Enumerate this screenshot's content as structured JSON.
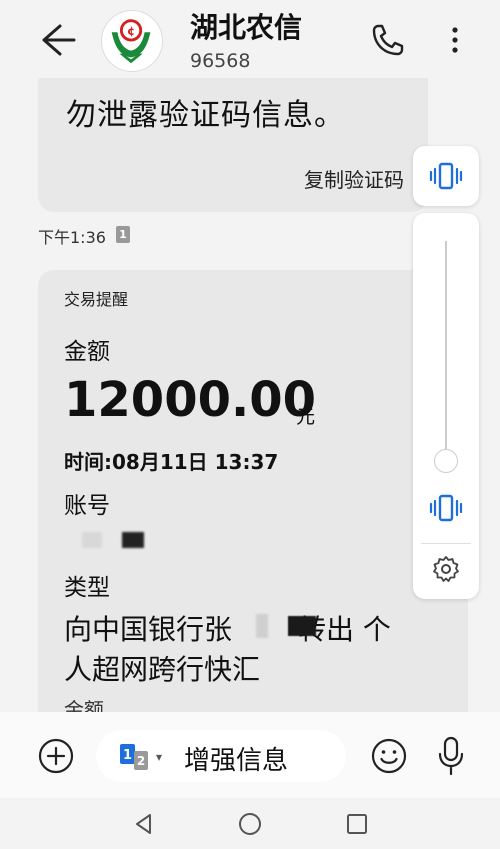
{
  "header": {
    "contact_name": "湖北农信",
    "contact_number": "96568"
  },
  "messages": [
    {
      "text": "勿泄露验证码信息。",
      "action": "复制验证码"
    }
  ],
  "timestamp": {
    "time": "下午1:36",
    "sim": "1"
  },
  "transaction": {
    "title": "交易提醒",
    "amount_label": "金额",
    "amount": "12000.00",
    "amount_unit": "元",
    "time": "时间:08月11日 13:37",
    "account_label": "账号",
    "type_label": "类型",
    "type_line1_prefix": "向中国银行张",
    "type_line1_suffix": "转出 个",
    "type_line2": "人超网跨行快汇",
    "next_label": "金额"
  },
  "volume": {
    "level": 0.05
  },
  "input_bar": {
    "text": "增强信息",
    "sim_primary": "1",
    "sim_secondary": "2"
  },
  "colors": {
    "accent_blue": "#1e6fd9",
    "brand_green": "#1a8a3a",
    "brand_red": "#d42020"
  }
}
